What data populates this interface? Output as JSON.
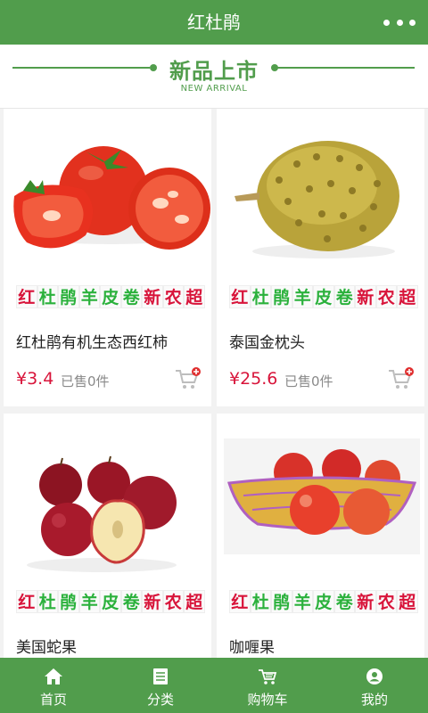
{
  "app": {
    "title": "红杜鹃",
    "more_icon": "more-dots-icon"
  },
  "section": {
    "title_cn": "新品上市",
    "title_en": "NEW ARRIVAL"
  },
  "slogan": [
    "红",
    "杜",
    "鹃",
    "羊",
    "皮",
    "卷",
    "新",
    "农",
    "超"
  ],
  "products": [
    {
      "name": "红杜鹃有机生态西红柿",
      "price": "¥3.4",
      "sold": "已售0件",
      "image": "tomato"
    },
    {
      "name": "泰国金枕头",
      "price": "¥25.6",
      "sold": "已售0件",
      "image": "durian"
    },
    {
      "name": "美国蛇果",
      "price": "",
      "sold": "",
      "image": "red-apples"
    },
    {
      "name": "咖喱果",
      "price": "",
      "sold": "",
      "image": "apple-basket"
    }
  ],
  "tabs": [
    {
      "label": "首页",
      "icon": "home-icon"
    },
    {
      "label": "分类",
      "icon": "list-icon"
    },
    {
      "label": "购物车",
      "icon": "cart-icon"
    },
    {
      "label": "我的",
      "icon": "user-icon"
    }
  ],
  "colors": {
    "brand": "#519d4c",
    "price": "#d8143a",
    "slogan_green": "#2bb13c",
    "slogan_red": "#d8143a"
  }
}
